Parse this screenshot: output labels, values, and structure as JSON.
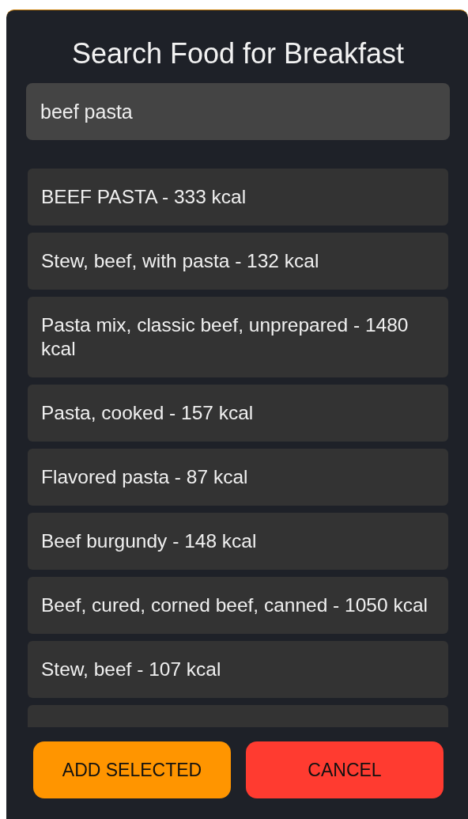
{
  "dialog": {
    "title": "Search Food for Breakfast"
  },
  "search": {
    "value": "beef pasta"
  },
  "results": [
    {
      "label": "BEEF PASTA - 333 kcal"
    },
    {
      "label": "Stew, beef, with pasta - 132 kcal"
    },
    {
      "label": "Pasta mix, classic beef, unprepared - 1480 kcal"
    },
    {
      "label": "Pasta, cooked - 157 kcal"
    },
    {
      "label": "Flavored pasta - 87 kcal"
    },
    {
      "label": "Beef burgundy - 148 kcal"
    },
    {
      "label": "Beef, cured, corned beef, canned - 1050 kcal"
    },
    {
      "label": "Stew, beef - 107 kcal"
    }
  ],
  "buttons": [
    {
      "label": "ADD SELECTED",
      "kind": "primary"
    },
    {
      "label": "CANCEL",
      "kind": "danger"
    }
  ]
}
